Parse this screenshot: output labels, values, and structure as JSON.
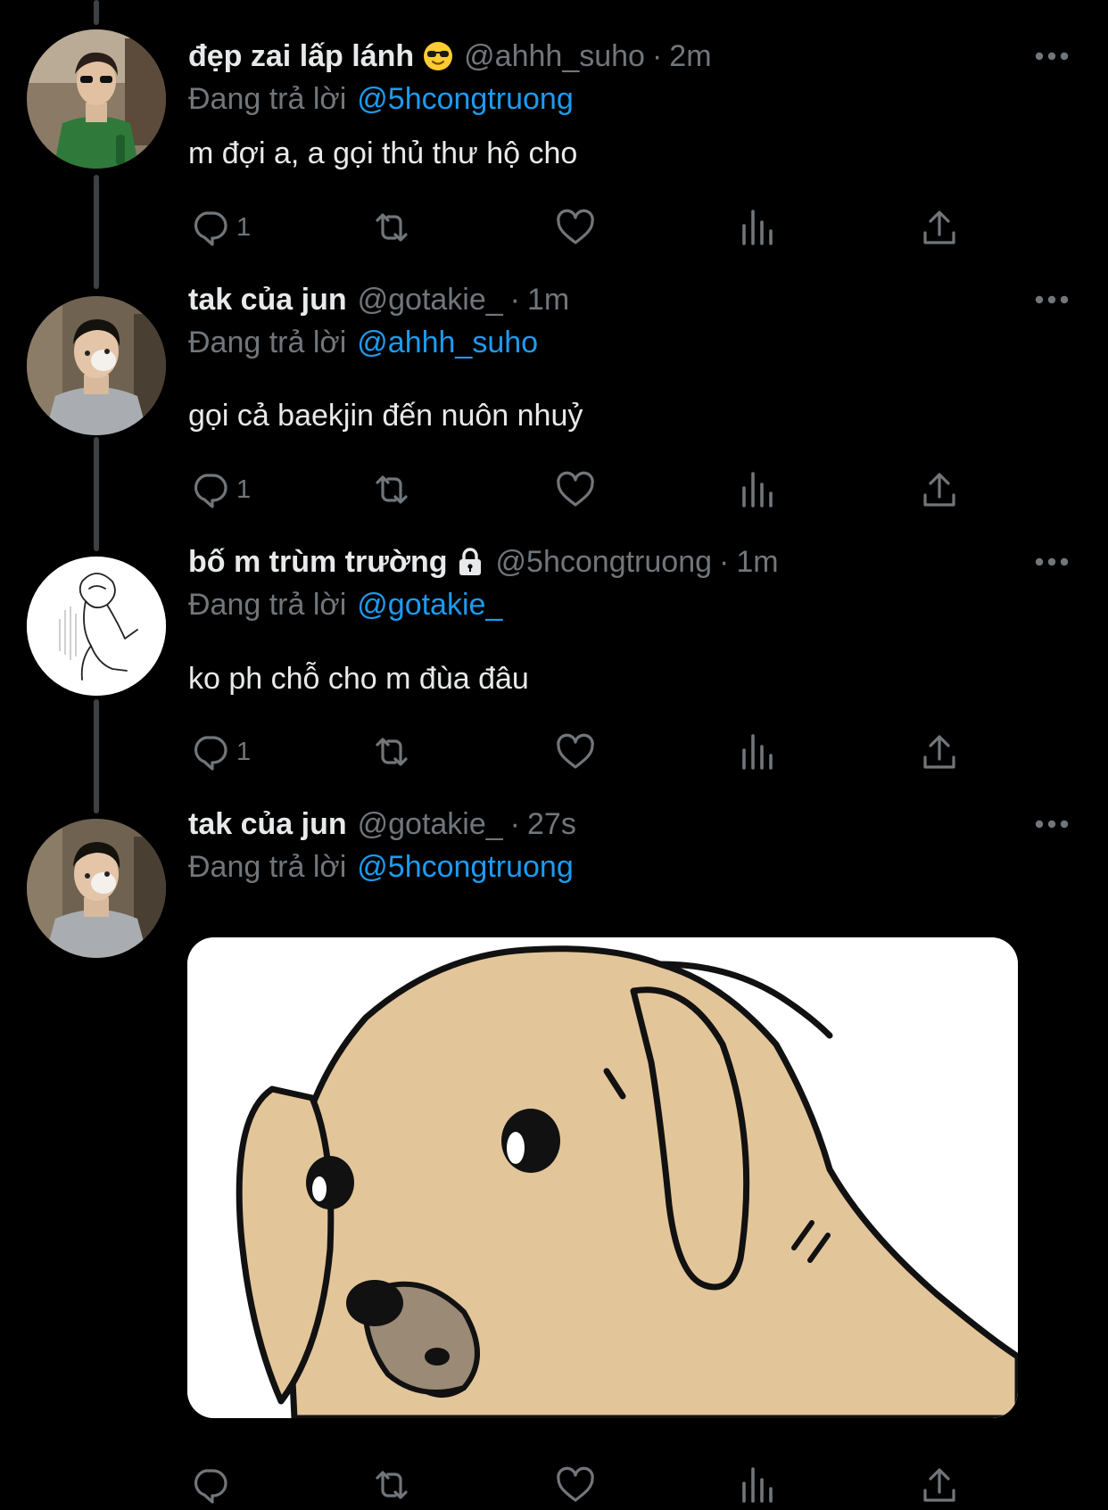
{
  "colors": {
    "background": "#000000",
    "text": "#e7e9ea",
    "muted": "#71767b",
    "link": "#1d9bf0",
    "thread_line": "#3e4144"
  },
  "tweets": [
    {
      "name": "đẹp zai lấp lánh",
      "name_emoji": "sunglasses-emoji",
      "handle": "@ahhh_suho",
      "sep": "·",
      "time": "2m",
      "replying_label": "Đang trả lời",
      "replying_to": "@5hcongtruong",
      "text": "m đợi a, a gọi thủ thư hộ cho",
      "actions": {
        "reply_count": "1",
        "retweet_count": "",
        "like_count": ""
      }
    },
    {
      "name": "tak của jun",
      "handle": "@gotakie_",
      "sep": "·",
      "time": "1m",
      "replying_label": "Đang trả lời",
      "replying_to": "@ahhh_suho",
      "text": "gọi cả baekjin đến nuôn nhuỷ",
      "actions": {
        "reply_count": "1",
        "retweet_count": "",
        "like_count": ""
      }
    },
    {
      "name": "bố m trùm trường",
      "name_icon": "lock-icon",
      "handle": "@5hcongtruong",
      "sep": "·",
      "time": "1m",
      "replying_label": "Đang trả lời",
      "replying_to": "@gotakie_",
      "text": "ko ph chỗ cho m đùa đâu",
      "actions": {
        "reply_count": "1",
        "retweet_count": "",
        "like_count": ""
      }
    },
    {
      "name": "tak của jun",
      "handle": "@gotakie_",
      "sep": "·",
      "time": "27s",
      "replying_label": "Đang trả lời",
      "replying_to": "@5hcongtruong",
      "media": "cartoon-dog-image",
      "actions": {
        "reply_count": "",
        "retweet_count": "",
        "like_count": ""
      }
    }
  ]
}
